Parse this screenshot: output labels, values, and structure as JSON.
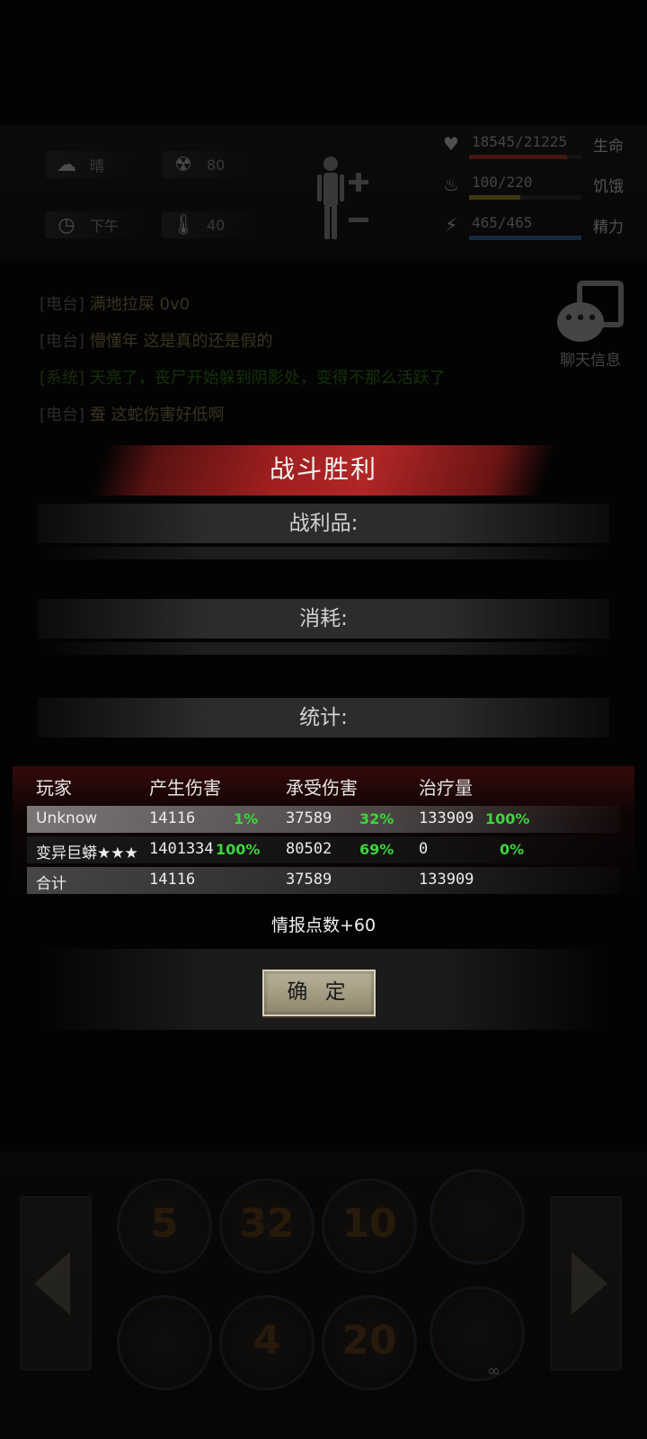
{
  "hud": {
    "weather": "晴",
    "radiation": "80",
    "time_of_day": "下午",
    "temperature": "40",
    "stats": [
      {
        "label": "生命",
        "value": "18545/21225",
        "fraction": 0.874,
        "color": "#c0392b",
        "icon": "heart-icon"
      },
      {
        "label": "饥饿",
        "value": "100/220",
        "fraction": 0.455,
        "color": "#b59a2a",
        "icon": "stomach-icon"
      },
      {
        "label": "精力",
        "value": "465/465",
        "fraction": 1.0,
        "color": "#2f6fb0",
        "icon": "energy-icon"
      }
    ]
  },
  "chat": {
    "messages": [
      {
        "tag": "[电台]",
        "text": "满地拉屎 0v0",
        "system": false
      },
      {
        "tag": "[电台]",
        "text": "懵懂年 这是真的还是假的",
        "system": false
      },
      {
        "tag": "[系统]",
        "text": "天亮了，丧尸开始躲到阴影处，变得不那么活跃了",
        "system": true
      },
      {
        "tag": "[电台]",
        "text": "蚕 这蛇伤害好低啊",
        "system": false
      }
    ],
    "button_label": "聊天信息"
  },
  "result": {
    "title": "战斗胜利",
    "loot_label": "战利品:",
    "consume_label": "消耗:",
    "stats_label": "统计:",
    "headers": [
      "玩家",
      "产生伤害",
      "承受伤害",
      "治疗量"
    ],
    "rows": [
      {
        "name": "Unknow",
        "dealt": "14116",
        "dealt_pct": "1%",
        "taken": "37589",
        "taken_pct": "32%",
        "heal": "133909",
        "heal_pct": "100%"
      },
      {
        "name": "变异巨蟒★★★",
        "dealt": "1401334",
        "dealt_pct": "100%",
        "taken": "80502",
        "taken_pct": "69%",
        "heal": "0",
        "heal_pct": "0%"
      },
      {
        "name": "合计",
        "dealt": "14116",
        "dealt_pct": "",
        "taken": "37589",
        "taken_pct": "",
        "heal": "133909",
        "heal_pct": ""
      }
    ],
    "intel": "情报点数+60",
    "confirm_label": "确 定"
  },
  "skills": [
    "5",
    "32",
    "10",
    "",
    "",
    "4",
    "20",
    ""
  ],
  "bottom_counter": "∞"
}
